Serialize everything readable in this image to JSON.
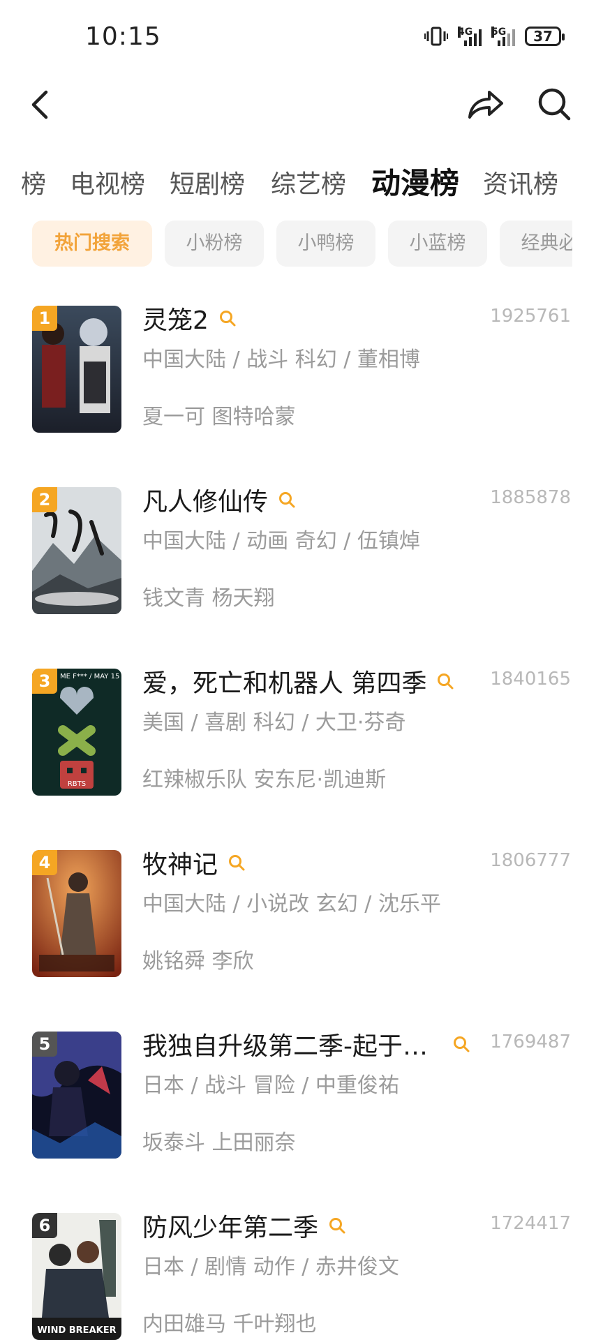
{
  "status_bar": {
    "time": "10:15",
    "net1": "4G",
    "net2": "5G",
    "battery": "37"
  },
  "header": {
    "back_icon": "chevron-left-icon",
    "share_icon": "share-arrow-icon",
    "search_icon": "search-icon"
  },
  "category_tabs": [
    "榜",
    "电视榜",
    "短剧榜",
    "综艺榜",
    "动漫榜",
    "资讯榜"
  ],
  "active_category": "动漫榜",
  "sub_tabs": [
    "热门搜索",
    "小粉榜",
    "小鸭榜",
    "小蓝榜",
    "经典必"
  ],
  "active_sub_tab": "热门搜索",
  "accent_color": "#f5a623",
  "items": [
    {
      "rank": "1",
      "title": "灵笼2",
      "heat": "1925761",
      "meta": "中国大陆 / 战斗 科幻 / 董相博",
      "cast": "夏一可 图特哈蒙"
    },
    {
      "rank": "2",
      "title": "凡人修仙传",
      "heat": "1885878",
      "meta": "中国大陆 / 动画 奇幻 / 伍镇焯",
      "cast": "钱文青 杨天翔"
    },
    {
      "rank": "3",
      "title": "爱，死亡和机器人 第四季",
      "heat": "1840165",
      "meta": "美国 / 喜剧 科幻 / 大卫·芬奇",
      "cast": "红辣椒乐队 安东尼·凯迪斯"
    },
    {
      "rank": "4",
      "title": "牧神记",
      "heat": "1806777",
      "meta": "中国大陆 / 小说改 玄幻 / 沈乐平",
      "cast": "姚铭舜 李欣"
    },
    {
      "rank": "5",
      "title": "我独自升级第二季-起于暗...",
      "heat": "1769487",
      "meta": "日本 / 战斗 冒险 / 中重俊祐",
      "cast": "坂泰斗 上田丽奈"
    },
    {
      "rank": "6",
      "title": "防风少年第二季",
      "heat": "1724417",
      "meta": "日本 / 剧情 动作 / 赤井俊文",
      "cast": "内田雄马 千叶翔也"
    }
  ],
  "posters": {
    "p3_text_top": "ME F*** / MAY 15",
    "p3_text_bottom": "RBTS",
    "p6_text": "WIND BREAKER"
  }
}
